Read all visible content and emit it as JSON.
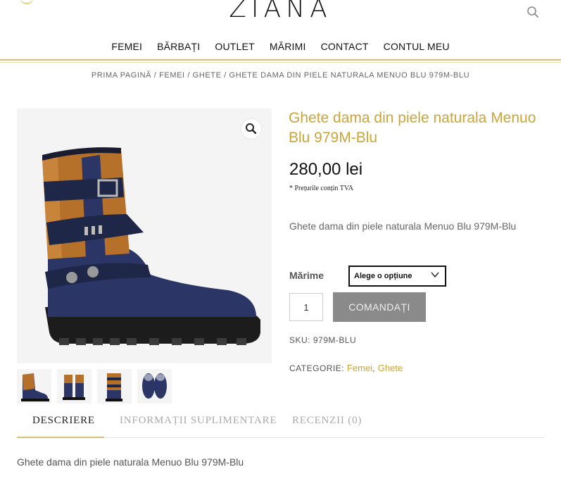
{
  "header": {
    "logo_text": "ZIANA",
    "search_icon": "search-icon"
  },
  "nav": {
    "items": [
      {
        "label": "FEMEI"
      },
      {
        "label": "BĂRBAȚI"
      },
      {
        "label": "OUTLET"
      },
      {
        "label": "MĂRIMI"
      },
      {
        "label": "CONTACT"
      },
      {
        "label": "CONTUL MEU"
      }
    ]
  },
  "breadcrumb": {
    "home": "PRIMA PAGINĂ",
    "sep": " / ",
    "women": "FEMEI",
    "boots": "GHETE",
    "current": "GHETE DAMA DIN PIELE NATURALA MENUO BLU 979M-BLU"
  },
  "gallery": {
    "zoom_icon": "magnifier-icon",
    "thumbnail_count": 4
  },
  "product": {
    "title": "Ghete dama din piele naturala Menuo Blu 979M-Blu",
    "price": "280,00 lei",
    "vat_note": "* Prețurile conțin TVA",
    "short_description": "Ghete dama din piele naturala Menuo Blu 979M-Blu",
    "size_label": "Mărime",
    "size_select_value": "Alege o opțiune",
    "quantity": "1",
    "order_button": "COMANDAȚI",
    "sku_label": "SKU:",
    "sku_value": "979M-BLU",
    "category_label": "CATEGORIE:",
    "categories": [
      "Femei",
      "Ghete"
    ],
    "category_sep": ", "
  },
  "tabs": {
    "items": [
      {
        "label": "DESCRIERE",
        "active": true
      },
      {
        "label": "INFORMAȚII SUPLIMENTARE",
        "active": false
      },
      {
        "label": "RECENZII (0)",
        "active": false
      }
    ]
  },
  "description": {
    "text": "Ghete dama din piele naturala Menuo Blu 979M-Blu"
  },
  "colors": {
    "accent_gold": "#c9a53a",
    "button_gray": "#8a8a8a",
    "boot_navy": "#2b3566",
    "boot_tan": "#b5702a"
  }
}
